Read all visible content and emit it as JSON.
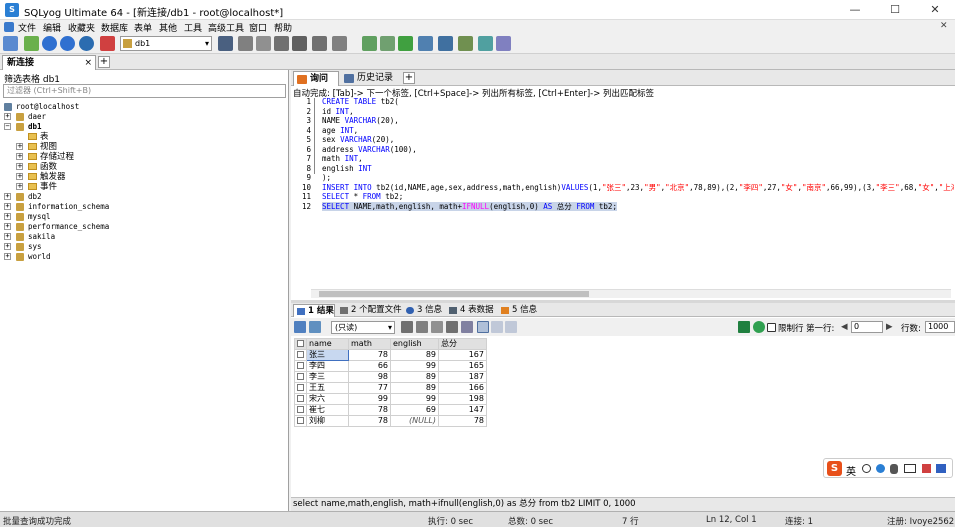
{
  "window": {
    "title": "SQLyog Ultimate 64 - [新连接/db1 - root@localhost*]",
    "controls": {
      "minimize": "—",
      "maximize": "☐",
      "close": "✕"
    }
  },
  "menu": [
    "文件",
    "编辑",
    "收藏夹",
    "数据库",
    "表单",
    "其他",
    "工具",
    "高级工具",
    "窗口",
    "帮助"
  ],
  "toolbar": {
    "database_selector": "db1",
    "restore_close": "✕"
  },
  "connection_tab": {
    "label": "新连接",
    "close": "×"
  },
  "left_panel": {
    "filter_label": "筛选表格 db1",
    "filter_placeholder": "过滤器 (Ctrl+Shift+B)",
    "root": "root@localhost",
    "databases": [
      {
        "name": "daer",
        "expanded": false
      },
      {
        "name": "db1",
        "expanded": true,
        "children": [
          "表",
          "视图",
          "存储过程",
          "函数",
          "触发器",
          "事件"
        ]
      },
      {
        "name": "db2",
        "expanded": false
      },
      {
        "name": "information_schema",
        "expanded": false
      },
      {
        "name": "mysql",
        "expanded": false
      },
      {
        "name": "performance_schema",
        "expanded": false
      },
      {
        "name": "sakila",
        "expanded": false
      },
      {
        "name": "sys",
        "expanded": false
      },
      {
        "name": "world",
        "expanded": false
      }
    ]
  },
  "editor": {
    "tabs": [
      {
        "label": "询问",
        "active": true
      },
      {
        "label": "历史记录",
        "active": false
      }
    ],
    "autocomplete_hint": "自动完成: [Tab]-> 下一个标签, [Ctrl+Space]-> 列出所有标签, [Ctrl+Enter]-> 列出匹配标签",
    "line_numbers": [
      "1",
      "2",
      "3",
      "4",
      "5",
      "6",
      "7",
      "8",
      "9",
      "10",
      "11",
      "12"
    ],
    "lines": [
      "CREATE TABLE tb2(",
      "id INT,",
      "NAME VARCHAR(20),",
      "age INT,",
      "sex VARCHAR(20),",
      "address VARCHAR(100),",
      "math INT,",
      "english INT",
      ");",
      "INSERT INTO tb2(id,NAME,age,sex,address,math,english)VALUES(1,\"张三\",23,\"男\",\"北京\",78,89),(2,\"李四\",27,\"女\",\"南京\",66,99),(3,\"李三\",68,\"女\",\"上海",
      "SELECT * FROM tb2;",
      "SELECT NAME,math,english, math+IFNULL(english,0) AS 总分 FROM tb2;"
    ]
  },
  "results": {
    "tabs": [
      {
        "label": "1 结果",
        "active": true
      },
      {
        "label": "2 个配置文件",
        "active": false
      },
      {
        "label": "3 信息",
        "active": false
      },
      {
        "label": "4 表数据",
        "active": false
      },
      {
        "label": "5 信息",
        "active": false
      }
    ],
    "mode_selector": "(只读)",
    "limit_rows_label": "限制行",
    "first_row_label": "第一行:",
    "first_row_value": "0",
    "rows_label": "行数:",
    "rows_value": "1000",
    "columns": [
      "name",
      "math",
      "english",
      "总分"
    ],
    "rows": [
      [
        "张三",
        "78",
        "89",
        "167"
      ],
      [
        "李四",
        "66",
        "99",
        "165"
      ],
      [
        "李三",
        "98",
        "89",
        "187"
      ],
      [
        "王五",
        "77",
        "89",
        "166"
      ],
      [
        "宋六",
        "99",
        "99",
        "198"
      ],
      [
        "崔七",
        "78",
        "69",
        "147"
      ],
      [
        "刘柳",
        "78",
        "(NULL)",
        "78"
      ]
    ],
    "executed_sql": "select name,math,english, math+ifnull(english,0) as 总分 from tb2 LIMIT 0, 1000"
  },
  "status_bar": {
    "message": "批量查询成功完成",
    "exec_time": "执行: 0 sec",
    "total_time": "总数: 0 sec",
    "row_count": "7 行",
    "cursor": "Ln 12, Col 1",
    "connections": "连接: 1",
    "registered": "注册: Ivoye2562"
  },
  "ime": {
    "lang": "英"
  },
  "colors": {
    "keyword": "#0000ff",
    "string": "#ff0000",
    "function": "#ff00ff",
    "selection": "#c8d4e8"
  }
}
